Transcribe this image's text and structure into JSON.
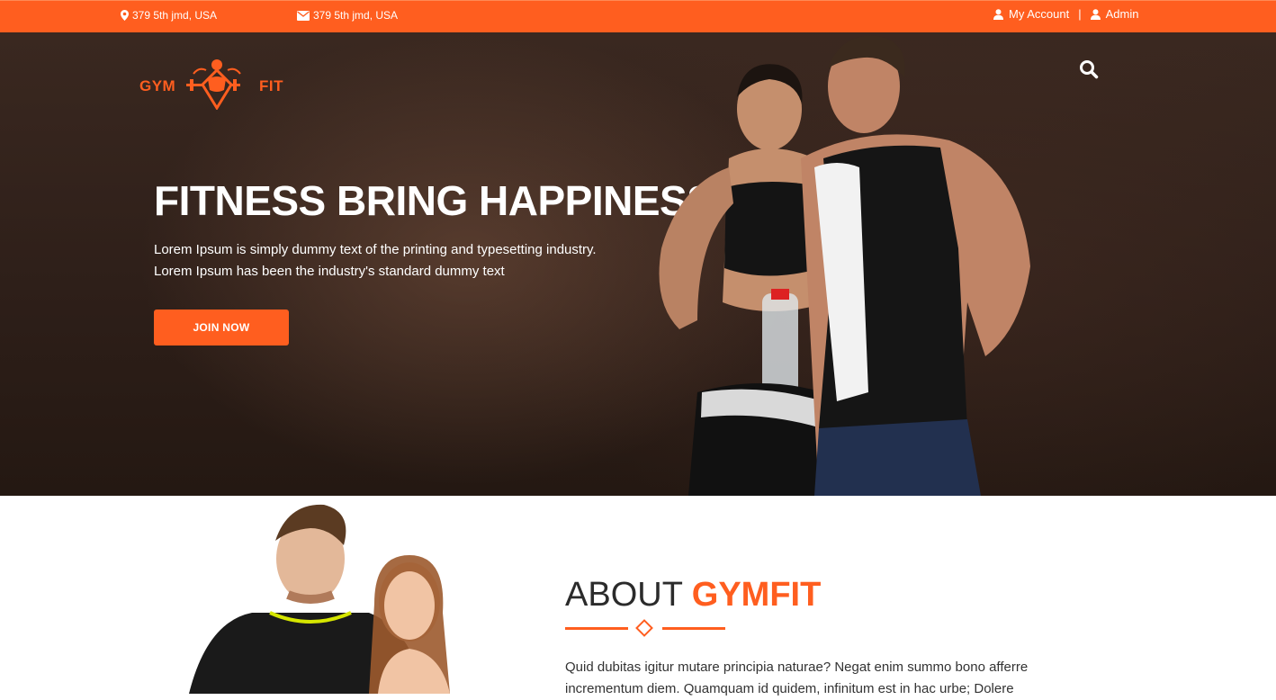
{
  "topbar": {
    "address": "379 5th jmd, USA",
    "email": "379 5th jmd, USA",
    "my_account": "My Account",
    "separator": "|",
    "admin": "Admin"
  },
  "brand": {
    "left": "GYM",
    "right": "FIT"
  },
  "hero": {
    "title": "FITNESS BRING HAPPINESS",
    "line1": "Lorem Ipsum is simply dummy text of the printing and typesetting industry.",
    "line2": "Lorem Ipsum has been the industry's standard dummy text",
    "cta": "JOIN NOW"
  },
  "about": {
    "title_prefix": "ABOUT",
    "title_accent": "GYMFIT",
    "text": "Quid dubitas igitur mutare principia naturae? Negat enim summo bono afferre incrementum diem. Quamquam id quidem, infinitum est in hac urbe; Dolere"
  },
  "colors": {
    "accent": "#ff5e1f",
    "topbar": "#ff5e1f",
    "hero_bg": "#2e1f19"
  },
  "icons": [
    "map-marker-icon",
    "envelope-icon",
    "user-icon",
    "search-icon",
    "diamond-icon"
  ]
}
